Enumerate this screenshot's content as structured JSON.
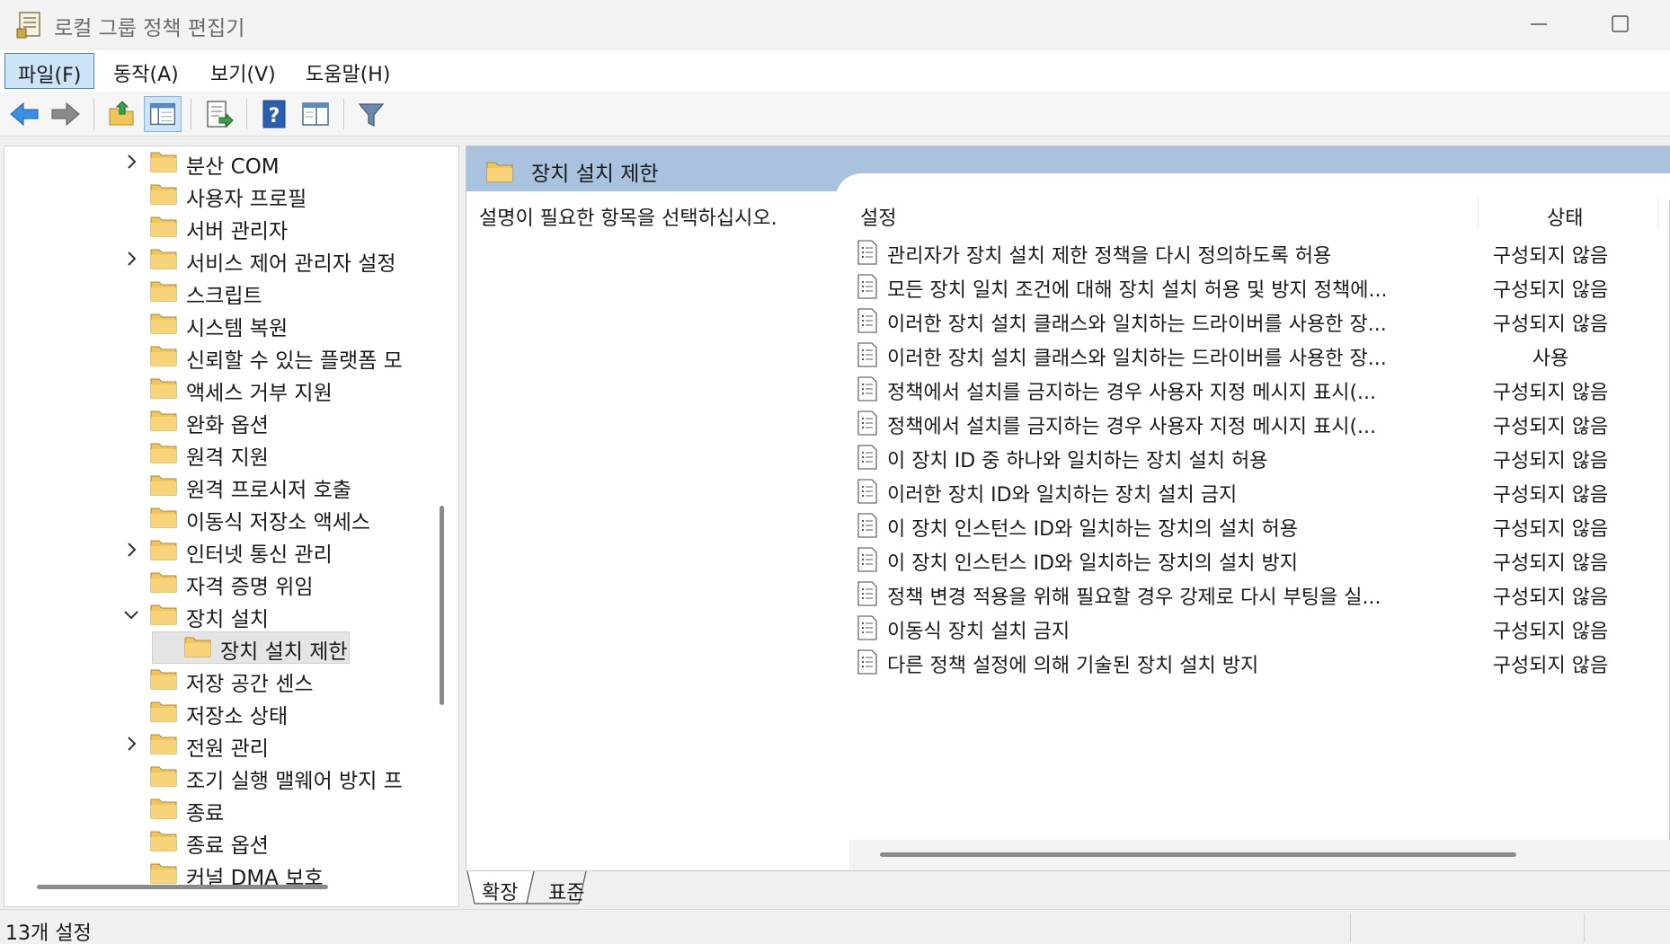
{
  "window": {
    "title": "로컬 그룹 정책 편집기"
  },
  "menu": [
    {
      "label": "파일(F)",
      "active": true
    },
    {
      "label": "동작(A)",
      "active": false
    },
    {
      "label": "보기(V)",
      "active": false
    },
    {
      "label": "도움말(H)",
      "active": false
    }
  ],
  "toolbar": {
    "icons": [
      "back-arrow-icon",
      "forward-arrow-icon",
      "up-folder-icon",
      "show-hide-tree-icon",
      "export-list-icon",
      "help-icon",
      "properties-view-icon",
      "filter-icon"
    ]
  },
  "tree": {
    "items": [
      {
        "label": "분산 COM",
        "expandable": true
      },
      {
        "label": "사용자 프로필",
        "expandable": false
      },
      {
        "label": "서버 관리자",
        "expandable": false
      },
      {
        "label": "서비스 제어 관리자 설정",
        "expandable": true
      },
      {
        "label": "스크립트",
        "expandable": false
      },
      {
        "label": "시스템 복원",
        "expandable": false
      },
      {
        "label": "신뢰할 수 있는 플랫폼 모",
        "expandable": false
      },
      {
        "label": "액세스 거부 지원",
        "expandable": false
      },
      {
        "label": "완화 옵션",
        "expandable": false
      },
      {
        "label": "원격 지원",
        "expandable": false
      },
      {
        "label": "원격 프로시저 호출",
        "expandable": false
      },
      {
        "label": "이동식 저장소 액세스",
        "expandable": false
      },
      {
        "label": "인터넷 통신 관리",
        "expandable": true
      },
      {
        "label": "자격 증명 위임",
        "expandable": false
      },
      {
        "label": "장치 설치",
        "expandable": true,
        "expanded": true
      },
      {
        "label": "장치 설치 제한",
        "expandable": false,
        "child": true,
        "selected": true
      },
      {
        "label": "저장 공간 센스",
        "expandable": false
      },
      {
        "label": "저장소 상태",
        "expandable": false
      },
      {
        "label": "전원 관리",
        "expandable": true
      },
      {
        "label": "조기 실행 맬웨어 방지 프",
        "expandable": false
      },
      {
        "label": "종료",
        "expandable": false
      },
      {
        "label": "종료 옵션",
        "expandable": false
      },
      {
        "label": "커널 DMA 보호",
        "expandable": false
      }
    ]
  },
  "details": {
    "header_title": "장치 설치 제한",
    "description": "설명이 필요한 항목을 선택하십시오.",
    "col_setting": "설정",
    "col_state": "상태",
    "rows": [
      {
        "name": "관리자가 장치 설치 제한 정책을 다시 정의하도록 허용",
        "state": "구성되지 않음"
      },
      {
        "name": "모든 장치 일치 조건에 대해 장치 설치 허용 및 방지 정책에...",
        "state": "구성되지 않음"
      },
      {
        "name": "이러한 장치 설치 클래스와 일치하는 드라이버를 사용한 장...",
        "state": "구성되지 않음"
      },
      {
        "name": "이러한 장치 설치 클래스와 일치하는 드라이버를 사용한 장...",
        "state": "사용"
      },
      {
        "name": "정책에서 설치를 금지하는 경우 사용자 지정 메시지 표시(...",
        "state": "구성되지 않음"
      },
      {
        "name": "정책에서 설치를 금지하는 경우 사용자 지정 메시지 표시(...",
        "state": "구성되지 않음"
      },
      {
        "name": "이 장치 ID 중 하나와 일치하는 장치 설치 허용",
        "state": "구성되지 않음"
      },
      {
        "name": "이러한 장치 ID와 일치하는 장치 설치 금지",
        "state": "구성되지 않음"
      },
      {
        "name": "이 장치 인스턴스 ID와 일치하는 장치의 설치 허용",
        "state": "구성되지 않음"
      },
      {
        "name": "이 장치 인스턴스 ID와 일치하는 장치의 설치 방지",
        "state": "구성되지 않음"
      },
      {
        "name": "정책 변경 적용을 위해 필요할 경우 강제로 다시 부팅을 실...",
        "state": "구성되지 않음"
      },
      {
        "name": "이동식 장치 설치 금지",
        "state": "구성되지 않음"
      },
      {
        "name": "다른 정책 설정에 의해 기술된 장치 설치 방지",
        "state": "구성되지 않음"
      }
    ]
  },
  "tabs": [
    {
      "label": "확장",
      "active": true
    },
    {
      "label": "표준",
      "active": false
    }
  ],
  "status": {
    "text": "13개 설정"
  },
  "colors": {
    "header_bg": "#a9c2de",
    "menu_active_bg": "#cce4f7",
    "folder": "#f2c45a"
  }
}
